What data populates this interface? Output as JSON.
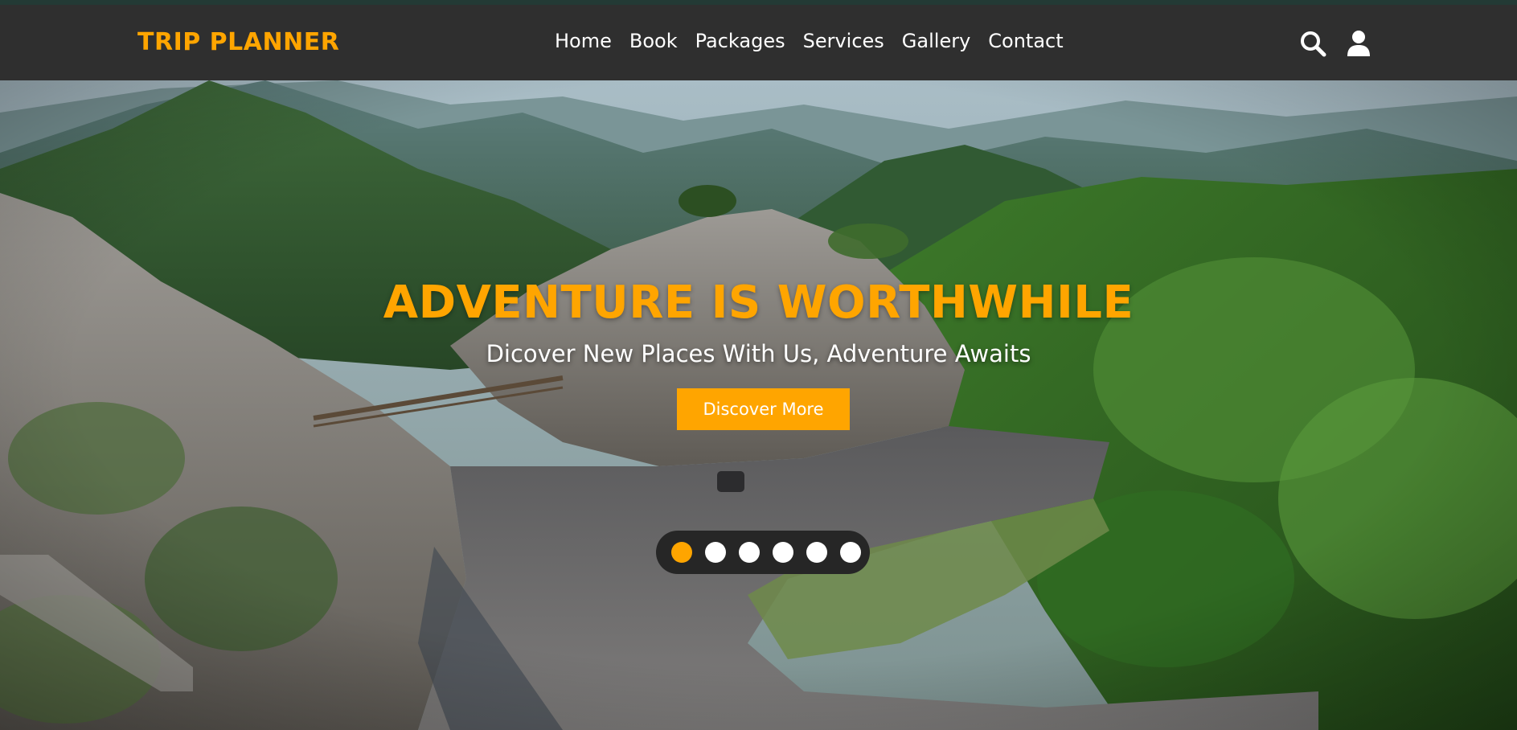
{
  "brand": {
    "logo": "TRIP PLANNER"
  },
  "nav": {
    "links": [
      "Home",
      "Book",
      "Packages",
      "Services",
      "Gallery",
      "Contact"
    ],
    "icons": [
      "search-icon",
      "user-icon"
    ]
  },
  "hero": {
    "headline": "ADVENTURE IS WORTHWHILE",
    "subline": "Dicover New Places With Us, Adventure Awaits",
    "cta_label": "Discover More",
    "slides_total": 6,
    "active_slide": 1
  },
  "colors": {
    "accent": "#ffa500",
    "navbar": "#2f2f2f",
    "dot_inactive": "#ffffff",
    "dot_bar": "#262626"
  }
}
